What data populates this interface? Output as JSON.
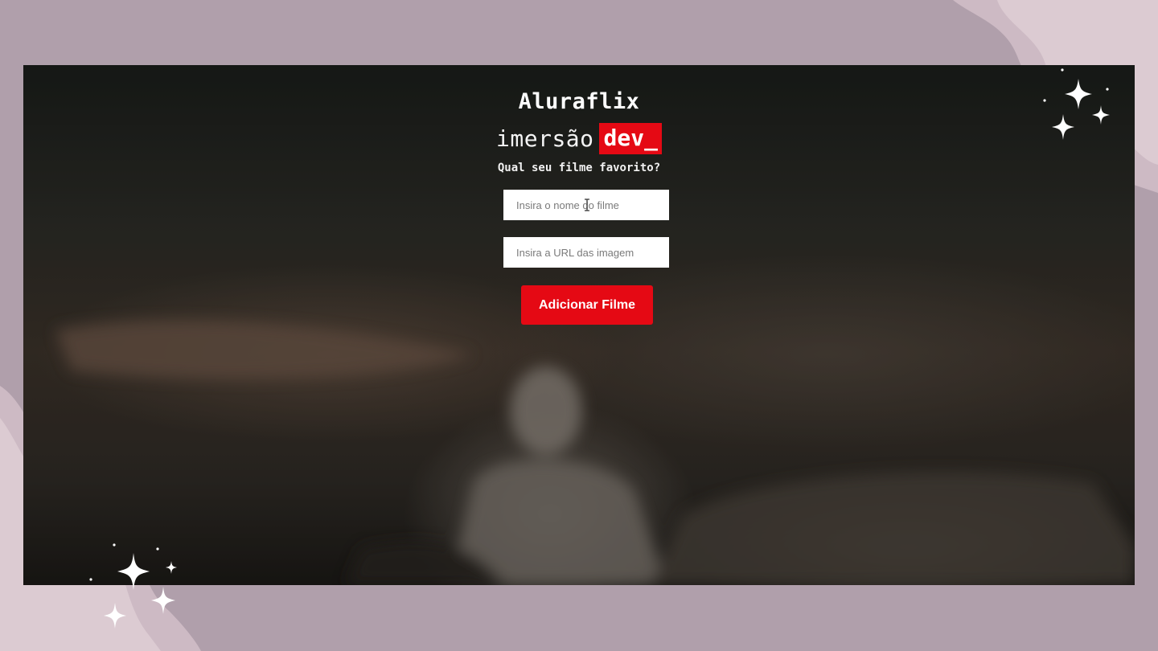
{
  "app": {
    "title": "Aluraflix",
    "brand_light": "imersão",
    "brand_badge": "dev_",
    "prompt": "Qual seu filme favorito?"
  },
  "form": {
    "movie_name_placeholder": "Insira o nome do filme",
    "movie_name_value": "",
    "image_url_placeholder": "Insira a URL das imagem",
    "image_url_value": "",
    "submit_label": "Adicionar Filme"
  },
  "colors": {
    "accent": "#e50914",
    "frame": "#b09fab",
    "frame_light": "#dccbd2",
    "text": "#ffffff"
  },
  "icons": {
    "cursor": "text-cursor-icon",
    "decoration": "sparkle-icon"
  }
}
